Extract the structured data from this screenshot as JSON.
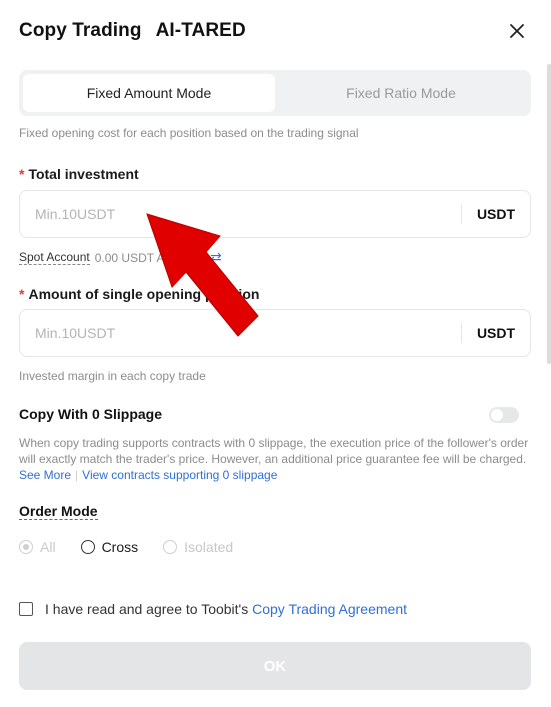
{
  "header": {
    "title": "Copy Trading",
    "trader": "AI-TARED"
  },
  "tabs": [
    {
      "label": "Fixed Amount Mode",
      "active": true
    },
    {
      "label": "Fixed Ratio Mode",
      "active": false
    }
  ],
  "mode_hint": "Fixed opening cost for each position based on the trading signal",
  "total_investment": {
    "label": "Total investment",
    "placeholder": "Min.10USDT",
    "unit": "USDT"
  },
  "account": {
    "name": "Spot Account",
    "balance": "0.00 USDT Available"
  },
  "single_position": {
    "label": "Amount of single opening position",
    "placeholder": "Min.10USDT",
    "unit": "USDT",
    "hint": "Invested margin in each copy trade"
  },
  "slippage": {
    "label": "Copy With 0 Slippage",
    "enabled": false,
    "description": "When copy trading supports contracts with 0 slippage, the execution price of the follower's order will exactly match the trader's price. However, an additional price guarantee fee will be charged.",
    "see_more": "See More",
    "view_contracts": "View contracts supporting 0 slippage"
  },
  "order_mode": {
    "label": "Order Mode",
    "options": [
      {
        "label": "All",
        "checked": true,
        "disabled": true
      },
      {
        "label": "Cross",
        "checked": false,
        "disabled": false
      },
      {
        "label": "Isolated",
        "checked": false,
        "disabled": true
      }
    ]
  },
  "agreement": {
    "text": "I have read and agree to Toobit's ",
    "link": "Copy Trading Agreement"
  },
  "ok_label": "OK",
  "colors": {
    "accent_link": "#2f6fd6",
    "required_star": "#e23b3b",
    "annotation_arrow": "#e00000"
  },
  "icons": [
    "close-icon",
    "swap-icon",
    "annotation-arrow"
  ]
}
